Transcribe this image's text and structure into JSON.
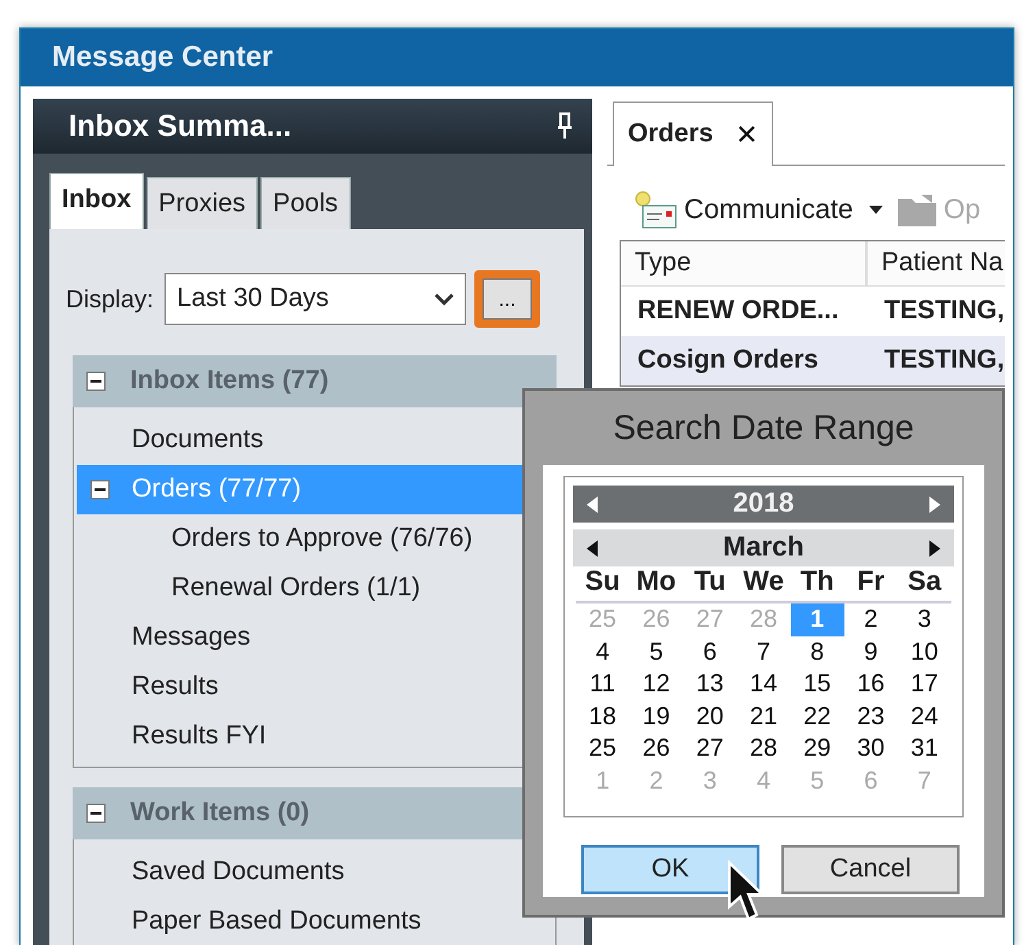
{
  "window": {
    "title": "Message Center"
  },
  "left_panel": {
    "title": "Inbox Summa...",
    "tabs": [
      {
        "label": "Inbox",
        "selected": true
      },
      {
        "label": "Proxies",
        "selected": false
      },
      {
        "label": "Pools",
        "selected": false
      }
    ],
    "display": {
      "label": "Display:",
      "value": "Last 30 Days",
      "browse_button": "..."
    },
    "sections": [
      {
        "title": "Inbox Items (77)",
        "expanded": true,
        "items": [
          {
            "label": "Documents",
            "selected": false
          },
          {
            "label": "Orders (77/77)",
            "selected": true,
            "expanded": true,
            "children": [
              {
                "label": "Orders to Approve (76/76)",
                "selected": false
              },
              {
                "label": "Renewal Orders (1/1)",
                "selected": false
              }
            ]
          },
          {
            "label": "Messages",
            "selected": false
          },
          {
            "label": "Results",
            "selected": false
          },
          {
            "label": "Results FYI",
            "selected": false
          }
        ]
      },
      {
        "title": "Work Items (0)",
        "expanded": true,
        "items": [
          {
            "label": "Saved Documents",
            "selected": false
          },
          {
            "label": "Paper Based Documents",
            "selected": false
          }
        ]
      }
    ]
  },
  "right_panel": {
    "tab": {
      "label": "Orders",
      "close": "✕"
    },
    "toolbar": [
      {
        "label": "Communicate",
        "kind": "menu",
        "disabled": false
      },
      {
        "label": "Op",
        "kind": "plain",
        "disabled": true
      }
    ],
    "table": {
      "columns": [
        "Type",
        "Patient Na"
      ],
      "rows": [
        {
          "cells": [
            "RENEW ORDE...",
            "TESTING,"
          ],
          "selected": false
        },
        {
          "cells": [
            "Cosign Orders",
            "TESTING,"
          ],
          "selected": true
        }
      ]
    }
  },
  "dialog": {
    "title": "Search Date Range",
    "year": "2018",
    "month": "March",
    "weekdays": [
      "Su",
      "Mo",
      "Tu",
      "We",
      "Th",
      "Fr",
      "Sa"
    ],
    "days": [
      {
        "text": "25",
        "outside": true,
        "selected": false
      },
      {
        "text": "26",
        "outside": true,
        "selected": false
      },
      {
        "text": "27",
        "outside": true,
        "selected": false
      },
      {
        "text": "28",
        "outside": true,
        "selected": false
      },
      {
        "text": "1",
        "outside": false,
        "selected": true
      },
      {
        "text": "2",
        "outside": false,
        "selected": false
      },
      {
        "text": "3",
        "outside": false,
        "selected": false
      },
      {
        "text": "4",
        "outside": false,
        "selected": false
      },
      {
        "text": "5",
        "outside": false,
        "selected": false
      },
      {
        "text": "6",
        "outside": false,
        "selected": false
      },
      {
        "text": "7",
        "outside": false,
        "selected": false
      },
      {
        "text": "8",
        "outside": false,
        "selected": false
      },
      {
        "text": "9",
        "outside": false,
        "selected": false
      },
      {
        "text": "10",
        "outside": false,
        "selected": false
      },
      {
        "text": "11",
        "outside": false,
        "selected": false
      },
      {
        "text": "12",
        "outside": false,
        "selected": false
      },
      {
        "text": "13",
        "outside": false,
        "selected": false
      },
      {
        "text": "14",
        "outside": false,
        "selected": false
      },
      {
        "text": "15",
        "outside": false,
        "selected": false
      },
      {
        "text": "16",
        "outside": false,
        "selected": false
      },
      {
        "text": "17",
        "outside": false,
        "selected": false
      },
      {
        "text": "18",
        "outside": false,
        "selected": false
      },
      {
        "text": "19",
        "outside": false,
        "selected": false
      },
      {
        "text": "20",
        "outside": false,
        "selected": false
      },
      {
        "text": "21",
        "outside": false,
        "selected": false
      },
      {
        "text": "22",
        "outside": false,
        "selected": false
      },
      {
        "text": "23",
        "outside": false,
        "selected": false
      },
      {
        "text": "24",
        "outside": false,
        "selected": false
      },
      {
        "text": "25",
        "outside": false,
        "selected": false
      },
      {
        "text": "26",
        "outside": false,
        "selected": false
      },
      {
        "text": "27",
        "outside": false,
        "selected": false
      },
      {
        "text": "28",
        "outside": false,
        "selected": false
      },
      {
        "text": "29",
        "outside": false,
        "selected": false
      },
      {
        "text": "30",
        "outside": false,
        "selected": false
      },
      {
        "text": "31",
        "outside": false,
        "selected": false
      },
      {
        "text": "1",
        "outside": true,
        "selected": false
      },
      {
        "text": "2",
        "outside": true,
        "selected": false
      },
      {
        "text": "3",
        "outside": true,
        "selected": false
      },
      {
        "text": "4",
        "outside": true,
        "selected": false
      },
      {
        "text": "5",
        "outside": true,
        "selected": false
      },
      {
        "text": "6",
        "outside": true,
        "selected": false
      },
      {
        "text": "7",
        "outside": true,
        "selected": false
      }
    ],
    "buttons": [
      {
        "label": "OK",
        "selected": true
      },
      {
        "label": "Cancel",
        "selected": false
      }
    ]
  }
}
